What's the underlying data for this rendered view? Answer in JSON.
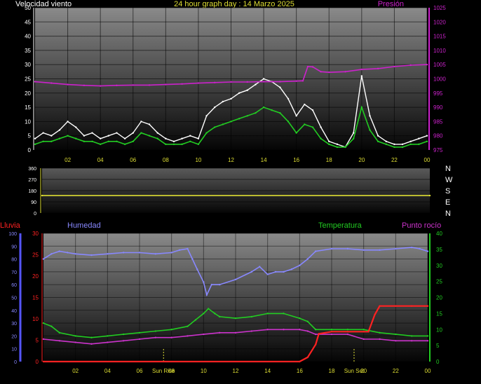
{
  "title": "24 hour graph day : 14 Marzo 2025",
  "colors": {
    "background": "#000000",
    "wind": "#ffffff",
    "wind_avg": "#22cc22",
    "pressure": "#cc22cc",
    "direction": "#dddd33",
    "rain": "#ff2222",
    "humidity": "#8888ff",
    "temperature": "#22cc22",
    "dewpoint": "#cc33cc",
    "axis_text": "#ffffff",
    "hour_text": "#dddd33"
  },
  "chart_data": [
    {
      "type": "line",
      "id": "wind",
      "title": "24 hour graph day : 14 Marzo 2025",
      "left_label": "Velocidad viento",
      "right_label": "Presión",
      "ylim": [
        0,
        50
      ],
      "yticks": [
        0,
        5,
        10,
        15,
        20,
        25,
        30,
        35,
        40,
        45,
        50
      ],
      "y2lim": [
        975,
        1025
      ],
      "y2ticks": [
        975,
        980,
        985,
        990,
        995,
        1000,
        1005,
        1010,
        1015,
        1020,
        1025
      ],
      "xlim": [
        0,
        24
      ],
      "xticks": [
        "02",
        "04",
        "06",
        "08",
        "10",
        "12",
        "14",
        "16",
        "18",
        "20",
        "22",
        "00"
      ],
      "grid": true,
      "series": [
        {
          "axis": "left",
          "style": "gust",
          "x": [
            0,
            0.5,
            1,
            1.5,
            2,
            2.5,
            3,
            3.5,
            4,
            4.5,
            5,
            5.5,
            6,
            6.5,
            7,
            7.5,
            8,
            8.5,
            9,
            9.5,
            10,
            10.5,
            11,
            11.5,
            12,
            12.5,
            13,
            13.5,
            14,
            14.5,
            15,
            15.5,
            16,
            16.5,
            17,
            17.5,
            18,
            18.5,
            19,
            19.5,
            20,
            20.5,
            21,
            21.5,
            22,
            22.5,
            23,
            23.5,
            24
          ],
          "values": [
            4,
            6,
            5,
            7,
            10,
            8,
            5,
            6,
            4,
            5,
            6,
            4,
            6,
            10,
            9,
            6,
            4,
            3,
            4,
            5,
            4,
            12,
            15,
            17,
            18,
            20,
            21,
            23,
            25,
            24,
            22,
            18,
            12,
            16,
            14,
            8,
            3,
            2,
            1,
            6,
            26,
            12,
            5,
            3,
            2,
            2,
            3,
            4,
            5
          ]
        },
        {
          "axis": "left",
          "style": "average",
          "x": [
            0,
            0.5,
            1,
            1.5,
            2,
            2.5,
            3,
            3.5,
            4,
            4.5,
            5,
            5.5,
            6,
            6.5,
            7,
            7.5,
            8,
            8.5,
            9,
            9.5,
            10,
            10.5,
            11,
            11.5,
            12,
            12.5,
            13,
            13.5,
            14,
            14.5,
            15,
            15.5,
            16,
            16.5,
            17,
            17.5,
            18,
            18.5,
            19,
            19.5,
            20,
            20.5,
            21,
            21.5,
            22,
            22.5,
            23,
            23.5,
            24
          ],
          "values": [
            2,
            3,
            3,
            4,
            5,
            4,
            3,
            3,
            2,
            3,
            3,
            2,
            3,
            6,
            5,
            4,
            2,
            2,
            2,
            3,
            2,
            6,
            8,
            9,
            10,
            11,
            12,
            13,
            15,
            14,
            13,
            10,
            6,
            9,
            8,
            4,
            2,
            1,
            1,
            4,
            15,
            7,
            3,
            2,
            1,
            1,
            2,
            2,
            3
          ]
        },
        {
          "axis": "right",
          "style": "pressure",
          "x": [
            0,
            1,
            2,
            3,
            4,
            5,
            6,
            7,
            8,
            9,
            10,
            11,
            12,
            13,
            14,
            15,
            16,
            16.4,
            16.7,
            17,
            17.5,
            18,
            19,
            20,
            21,
            22,
            23,
            24
          ],
          "values": [
            999,
            998.5,
            998,
            997.7,
            997.5,
            997.7,
            997.8,
            997.8,
            998,
            998.2,
            998.5,
            998.7,
            998.9,
            998.9,
            999,
            999,
            999.2,
            999.3,
            1004.3,
            1004.2,
            1002.5,
            1002.3,
            1002.5,
            1003.3,
            1003.6,
            1004.3,
            1004.8,
            1005
          ]
        }
      ]
    },
    {
      "type": "line",
      "id": "direction",
      "right_labels": [
        "N",
        "W",
        "S",
        "E",
        "N"
      ],
      "ylim": [
        0,
        360
      ],
      "yticks": [
        0,
        90,
        180,
        270,
        360
      ],
      "yticklabels": [
        "0",
        "90",
        "180",
        "270",
        "360"
      ],
      "xlim": [
        0,
        24
      ],
      "grid": true,
      "series": [
        {
          "style": "direction",
          "x": [
            0,
            24
          ],
          "values": [
            140,
            140
          ]
        }
      ]
    },
    {
      "type": "line",
      "id": "weather",
      "labels": [
        "Lluvia",
        "Humedad",
        "Temperatura",
        "Punto rocío"
      ],
      "ylim_humidity": [
        0,
        100
      ],
      "yticks_humidity": [
        0,
        10,
        20,
        30,
        40,
        50,
        60,
        70,
        80,
        90,
        100
      ],
      "ylim_rain": [
        0,
        30
      ],
      "yticks_rain": [
        0,
        5,
        10,
        15,
        20,
        25,
        30
      ],
      "ylim_temp": [
        0,
        40
      ],
      "yticks_temp": [
        0,
        5,
        10,
        15,
        20,
        25,
        30,
        35,
        40
      ],
      "xlim": [
        0,
        24
      ],
      "xticks": [
        "02",
        "04",
        "06",
        "08",
        "10",
        "12",
        "14",
        "16",
        "18",
        "20",
        "22",
        "00"
      ],
      "sun_rise": {
        "label": "Sun Rise",
        "x": 7.5
      },
      "sun_set": {
        "label": "Sun Set",
        "x": 19.4
      },
      "grid": true,
      "series": [
        {
          "axis": "humidity",
          "style": "humidity",
          "x": [
            0,
            0.5,
            1,
            1.5,
            2,
            3,
            4,
            5,
            6,
            7,
            8,
            8.5,
            9,
            9.3,
            9.6,
            10,
            10.2,
            10.5,
            11,
            12,
            13,
            13.5,
            14,
            14.5,
            15,
            15.5,
            16,
            16.5,
            17,
            18,
            19,
            20,
            21,
            22,
            23,
            23.5,
            24
          ],
          "values": [
            80,
            84,
            86,
            85,
            84,
            83,
            84,
            85,
            85,
            84,
            85,
            87,
            88,
            80,
            72,
            62,
            52,
            60,
            60,
            64,
            70,
            74,
            68,
            70,
            70,
            72,
            75,
            80,
            86,
            88,
            88,
            87,
            87,
            88,
            89,
            88,
            86
          ]
        },
        {
          "axis": "temp",
          "style": "temperature",
          "x": [
            0,
            0.5,
            1,
            2,
            3,
            4,
            5,
            6,
            7,
            8,
            9,
            9.5,
            10,
            10.3,
            10.7,
            11,
            12,
            13,
            14,
            15,
            16,
            16.5,
            17,
            18,
            19,
            20,
            21,
            22,
            23,
            24
          ],
          "values": [
            12,
            11,
            9,
            8,
            7.5,
            8,
            8.5,
            9,
            9.5,
            10,
            11,
            13,
            15,
            16.5,
            15,
            14,
            13.5,
            14,
            15,
            15,
            13.5,
            12.5,
            10,
            10,
            10,
            10,
            9,
            8.5,
            8,
            8
          ]
        },
        {
          "axis": "temp",
          "style": "dewpoint",
          "x": [
            0,
            1,
            2,
            3,
            4,
            5,
            6,
            7,
            8,
            9,
            10,
            11,
            12,
            13,
            14,
            15,
            16,
            16.5,
            17,
            18,
            19,
            20,
            21,
            22,
            23,
            24
          ],
          "values": [
            7,
            6.5,
            6,
            5.5,
            6,
            6.5,
            7,
            7.5,
            7.5,
            8,
            8.5,
            9,
            9,
            9.5,
            10,
            10,
            10,
            9.5,
            8.5,
            8.5,
            8.5,
            7,
            7,
            6.5,
            6.5,
            6.5
          ]
        },
        {
          "axis": "rain",
          "style": "rain",
          "x": [
            0,
            16,
            16.5,
            17,
            17.2,
            18,
            19,
            20,
            20.3,
            20.7,
            21,
            22,
            23,
            23.8,
            24
          ],
          "values": [
            0,
            0,
            1,
            4,
            6.5,
            7,
            7,
            7,
            7,
            11,
            13,
            13,
            13,
            13,
            13
          ]
        }
      ]
    }
  ]
}
